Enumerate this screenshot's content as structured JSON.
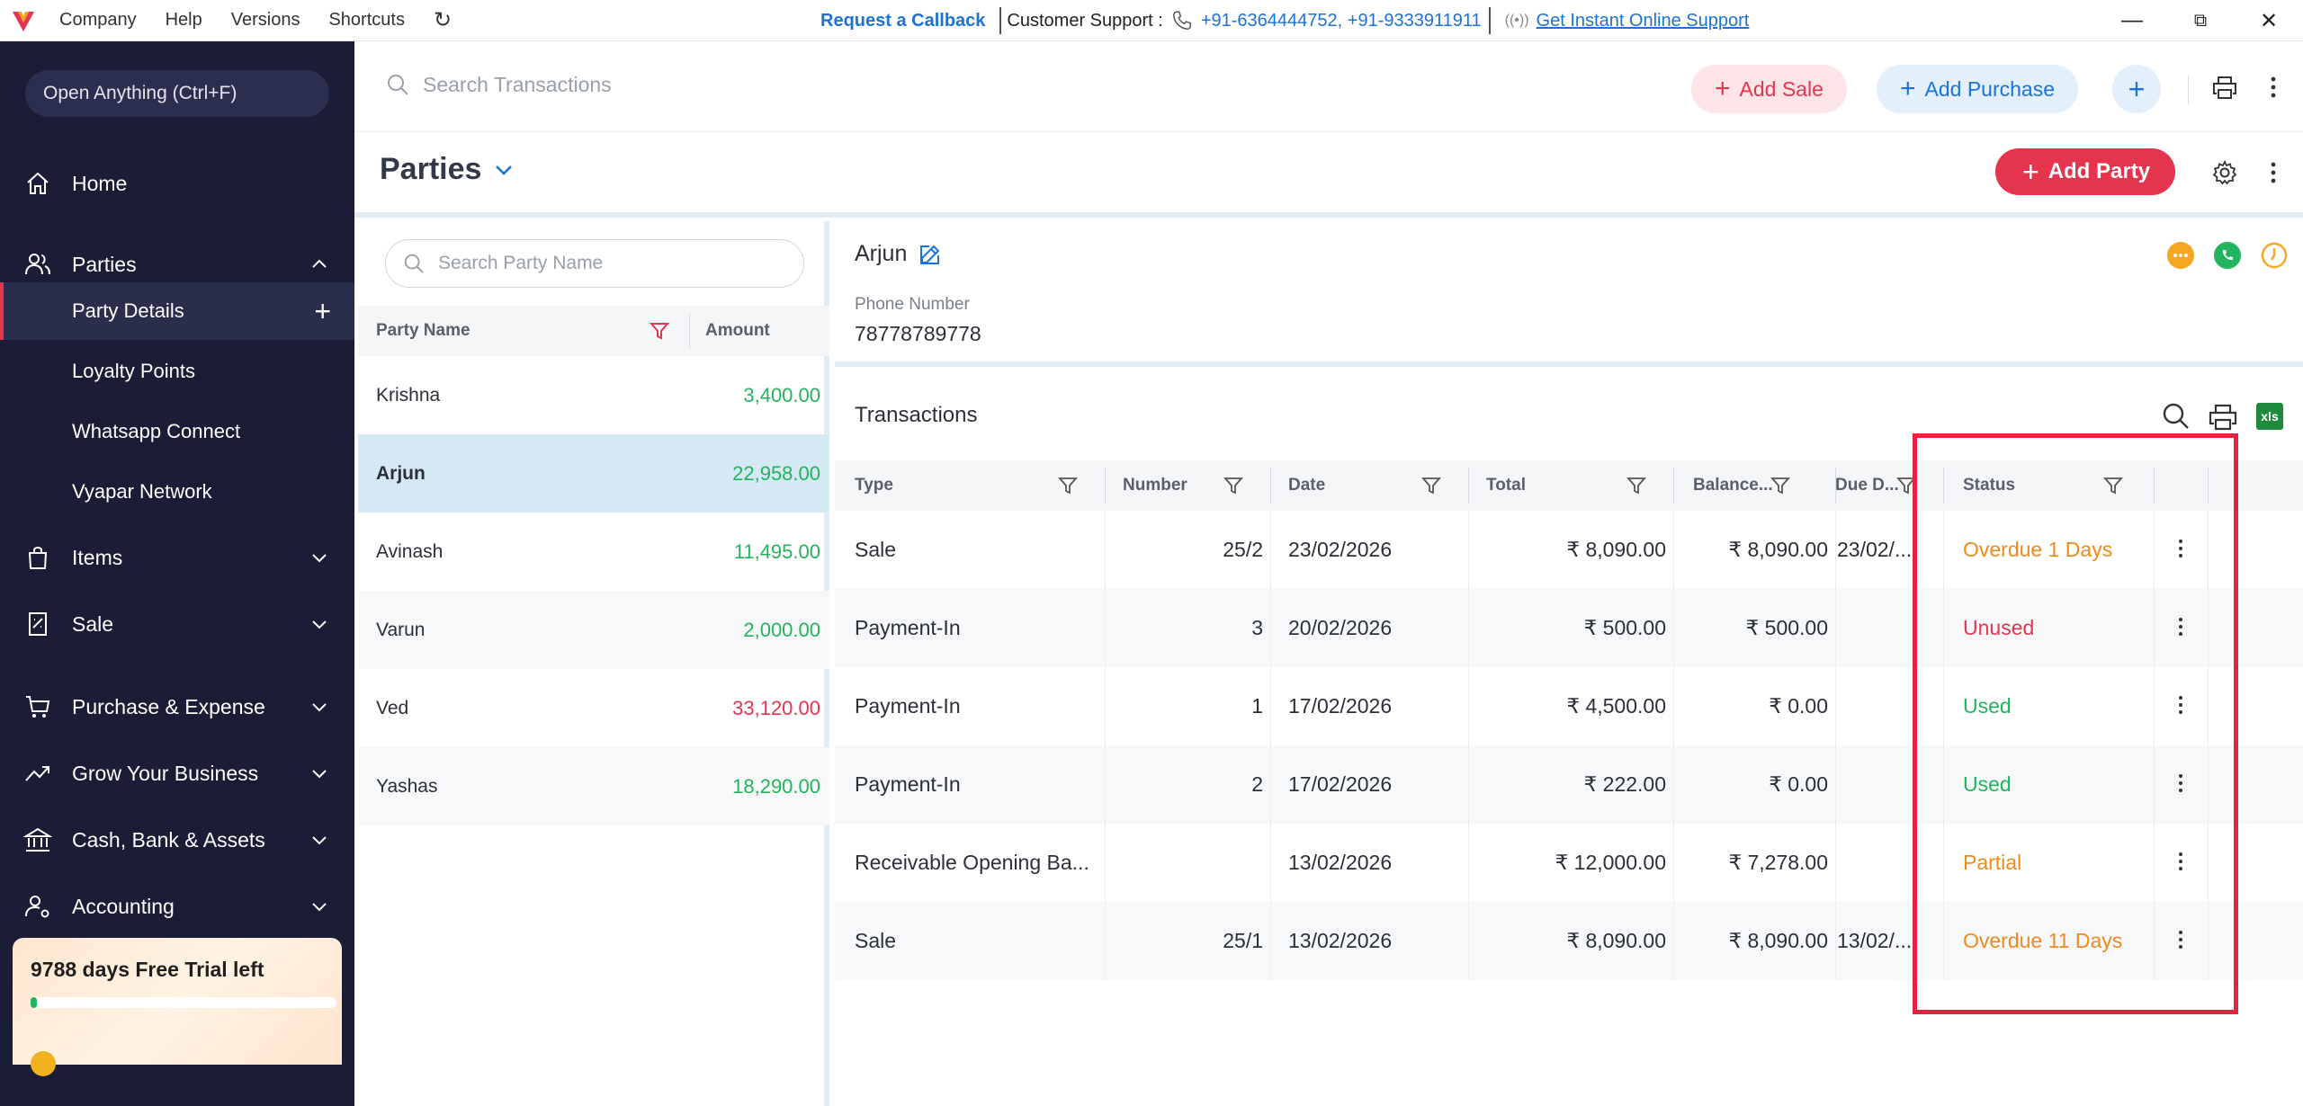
{
  "topbar": {
    "menu": [
      "Company",
      "Help",
      "Versions",
      "Shortcuts"
    ],
    "request_callback": "Request a Callback",
    "support_label": "Customer Support :",
    "support_phones": "+91-6364444752, +91-9333911911",
    "online_support": "Get Instant Online Support"
  },
  "sidebar": {
    "open_anything": "Open Anything (Ctrl+F)",
    "items": [
      {
        "label": "Home",
        "icon": "home-icon"
      },
      {
        "label": "Parties",
        "icon": "users-icon"
      },
      {
        "label": "Items",
        "icon": "bag-icon"
      },
      {
        "label": "Sale",
        "icon": "receipt-icon"
      },
      {
        "label": "Purchase & Expense",
        "icon": "cart-icon"
      },
      {
        "label": "Grow Your Business",
        "icon": "trend-icon"
      },
      {
        "label": "Cash, Bank & Assets",
        "icon": "bank-icon"
      },
      {
        "label": "Accounting",
        "icon": "user-settings-icon"
      }
    ],
    "sub_items": [
      "Party Details",
      "Loyalty Points",
      "Whatsapp Connect",
      "Vyapar Network"
    ],
    "trial": {
      "text": "9788 days Free Trial left",
      "progress": 0.02
    }
  },
  "header": {
    "search_placeholder": "Search Transactions",
    "add_sale": "Add Sale",
    "add_purchase": "Add Purchase"
  },
  "parties": {
    "title": "Parties",
    "add_party": "Add Party",
    "search_placeholder": "Search Party Name",
    "col_name": "Party Name",
    "col_amount": "Amount",
    "list": [
      {
        "name": "Krishna",
        "amount": "3,400.00",
        "color": "#22b45c"
      },
      {
        "name": "Arjun",
        "amount": "22,958.00",
        "color": "#22b45c"
      },
      {
        "name": "Avinash",
        "amount": "11,495.00",
        "color": "#22b45c"
      },
      {
        "name": "Varun",
        "amount": "2,000.00",
        "color": "#22b45c"
      },
      {
        "name": "Ved",
        "amount": "33,120.00",
        "color": "#e5344e"
      },
      {
        "name": "Yashas",
        "amount": "18,290.00",
        "color": "#22b45c"
      }
    ]
  },
  "detail": {
    "name": "Arjun",
    "phone_label": "Phone Number",
    "phone": "78778789778"
  },
  "transactions": {
    "title": "Transactions",
    "xls": "xls",
    "columns": [
      "Type",
      "Number",
      "Date",
      "Total",
      "Balance...",
      "Due D...",
      "Status"
    ],
    "rows": [
      {
        "type": "Sale",
        "number": "25/2",
        "date": "23/02/2026",
        "total": "₹ 8,090.00",
        "balance": "₹ 8,090.00",
        "due": "23/02/...",
        "status": "Overdue 1 Days",
        "status_class": "st-overdue"
      },
      {
        "type": "Payment-In",
        "number": "3",
        "date": "20/02/2026",
        "total": "₹ 500.00",
        "balance": "₹ 500.00",
        "due": "",
        "status": "Unused",
        "status_class": "st-unused"
      },
      {
        "type": "Payment-In",
        "number": "1",
        "date": "17/02/2026",
        "total": "₹ 4,500.00",
        "balance": "₹ 0.00",
        "due": "",
        "status": "Used",
        "status_class": "st-used"
      },
      {
        "type": "Payment-In",
        "number": "2",
        "date": "17/02/2026",
        "total": "₹ 222.00",
        "balance": "₹ 0.00",
        "due": "",
        "status": "Used",
        "status_class": "st-used"
      },
      {
        "type": "Receivable Opening Ba...",
        "number": "",
        "date": "13/02/2026",
        "total": "₹ 12,000.00",
        "balance": "₹ 7,278.00",
        "due": "",
        "status": "Partial",
        "status_class": "st-partial"
      },
      {
        "type": "Sale",
        "number": "25/1",
        "date": "13/02/2026",
        "total": "₹ 8,090.00",
        "balance": "₹ 8,090.00",
        "due": "13/02/...",
        "status": "Overdue 11 Days",
        "status_class": "st-overdue"
      }
    ]
  }
}
